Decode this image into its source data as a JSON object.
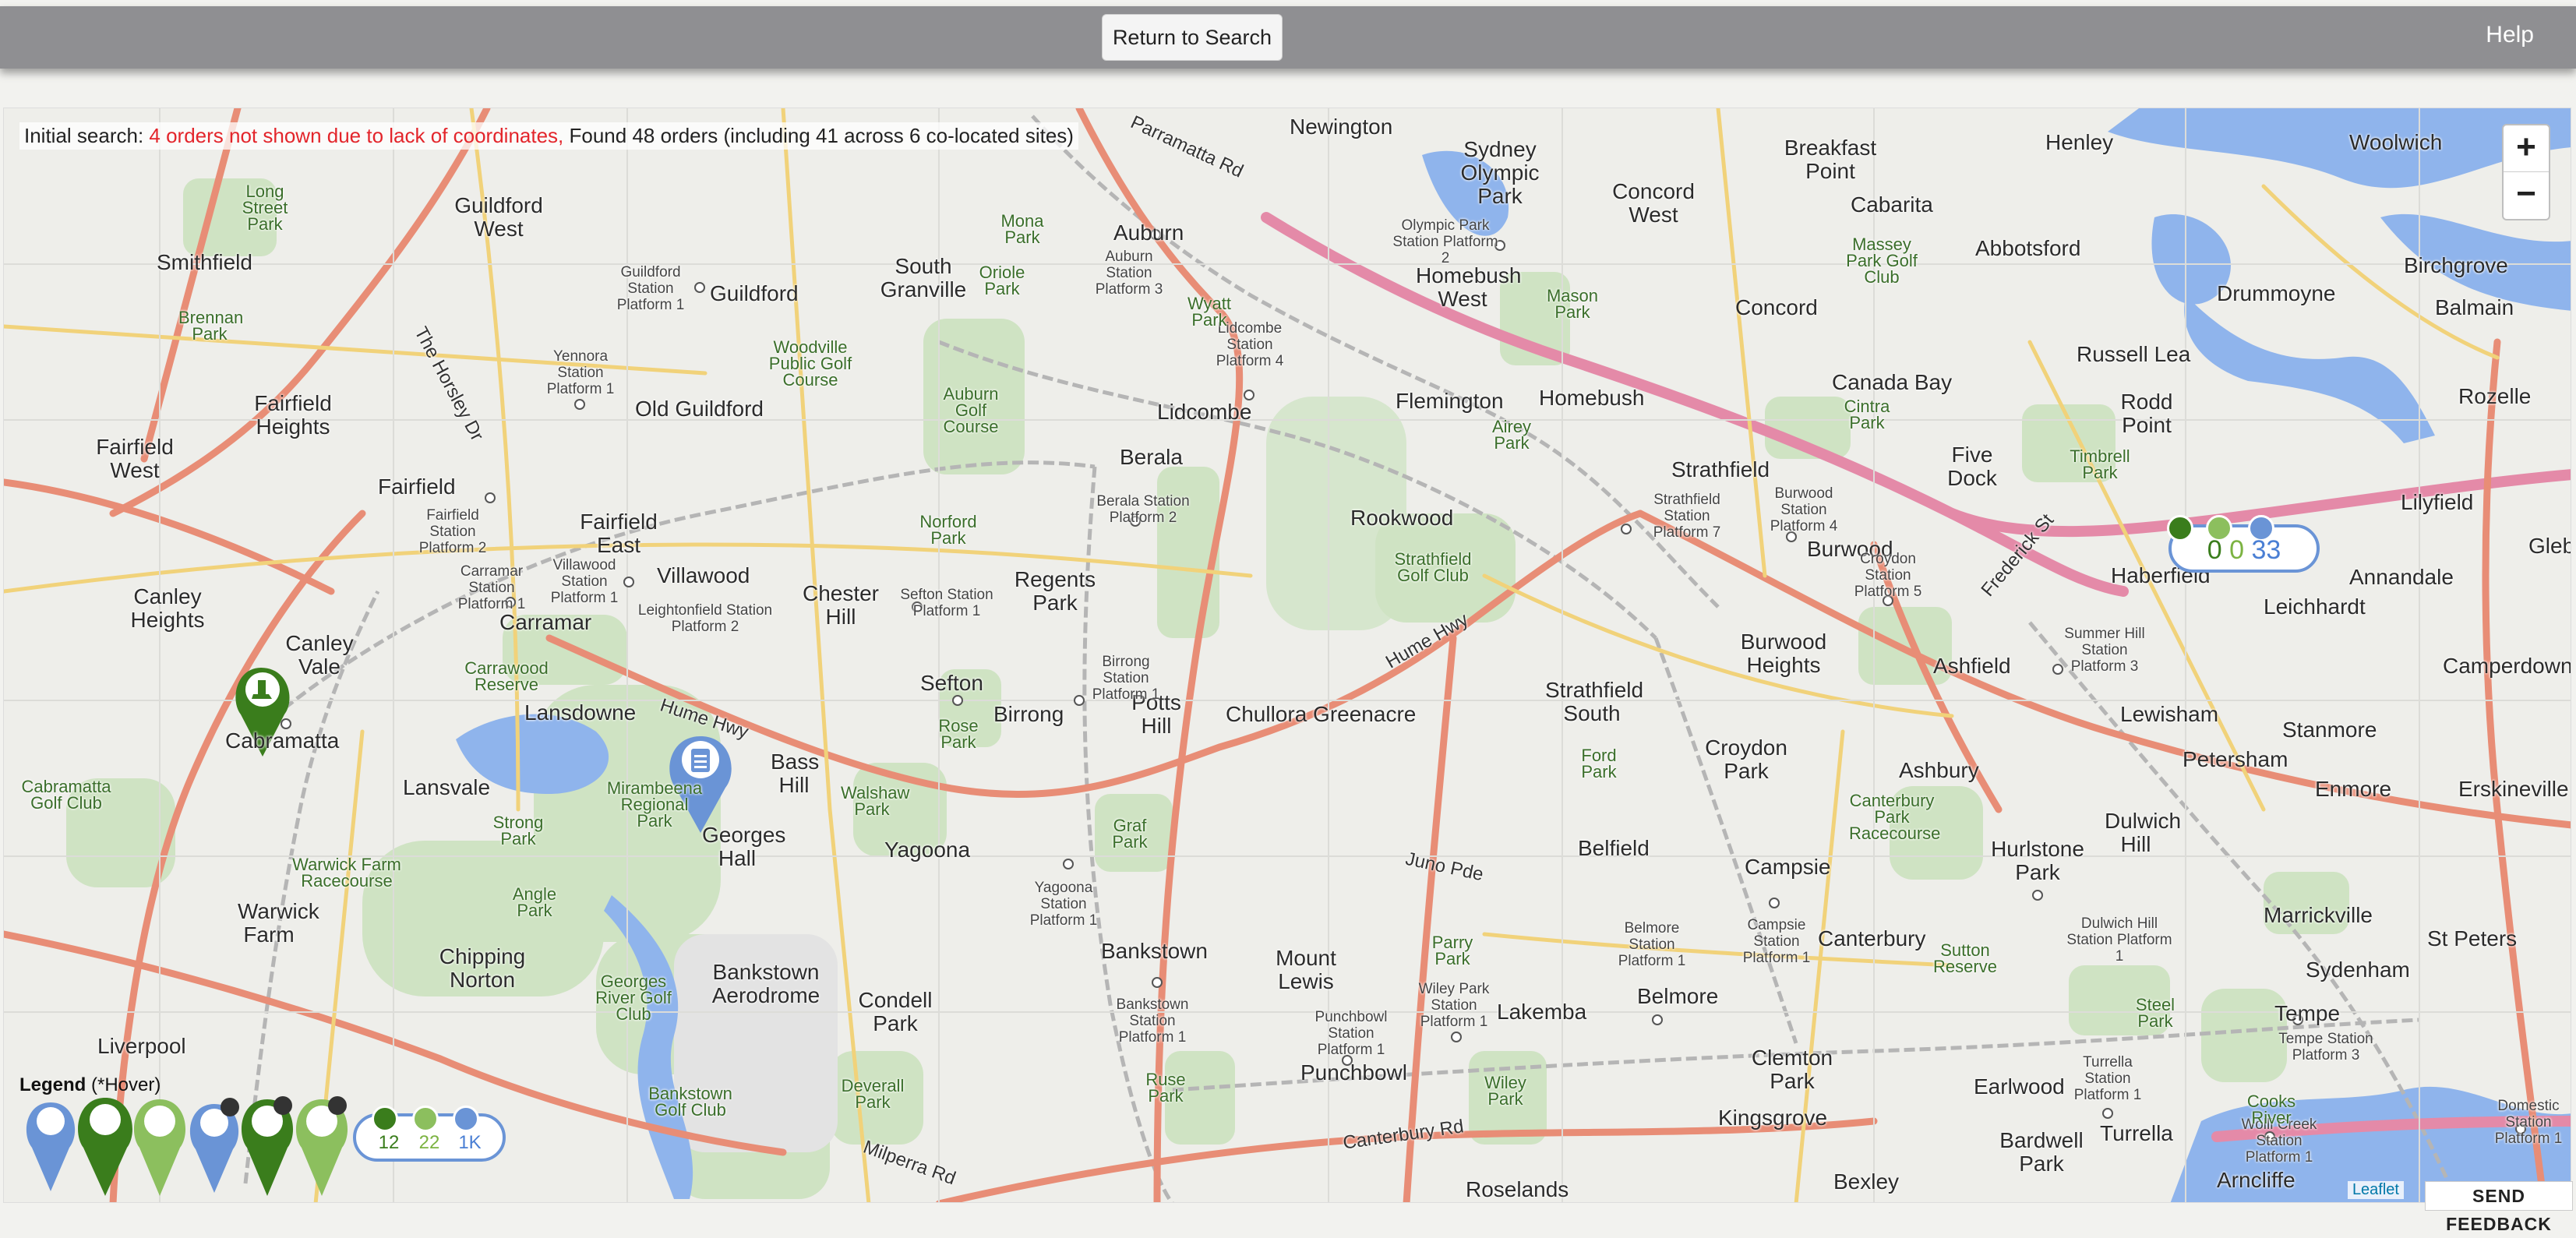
{
  "header": {
    "return_label": "Return to Search",
    "help_label": "Help"
  },
  "search": {
    "prefix": "Initial search: ",
    "warning": "4 orders not shown due to lack of coordinates,",
    "found": " Found 48 orders (including 41 across 6 co-located sites)"
  },
  "zoom": {
    "in": "+",
    "out": "−"
  },
  "cluster": {
    "green": "0",
    "lightgreen": "0",
    "blue": "33"
  },
  "legend": {
    "title": "Legend",
    "hint": " (*Hover)",
    "counts": {
      "green": "12",
      "lightgreen": "22",
      "blue": "1K"
    }
  },
  "attribution": "Leaflet",
  "feedback_label": "SEND FEEDBACK",
  "places": [
    {
      "id": "newington",
      "label": "Newington"
    },
    {
      "id": "sydney-olympic-park",
      "label": "Sydney Olympic Park"
    },
    {
      "id": "concord-west",
      "label": "Concord West"
    },
    {
      "id": "breakfast-point",
      "label": "Breakfast Point"
    },
    {
      "id": "henley",
      "label": "Henley"
    },
    {
      "id": "woolwich",
      "label": "Woolwich"
    },
    {
      "id": "guildford-west",
      "label": "Guildford West"
    },
    {
      "id": "smithfield",
      "label": "Smithfield"
    },
    {
      "id": "auburn",
      "label": "Auburn"
    },
    {
      "id": "cabarita",
      "label": "Cabarita"
    },
    {
      "id": "abbotsford",
      "label": "Abbotsford"
    },
    {
      "id": "birchgrove",
      "label": "Birchgrove"
    },
    {
      "id": "south-granville",
      "label": "South Granville"
    },
    {
      "id": "guildford",
      "label": "Guildford"
    },
    {
      "id": "homebush-west",
      "label": "Homebush West"
    },
    {
      "id": "concord",
      "label": "Concord"
    },
    {
      "id": "drummoyne",
      "label": "Drummoyne"
    },
    {
      "id": "balmain",
      "label": "Balmain"
    },
    {
      "id": "fairfield-heights",
      "label": "Fairfield Heights"
    },
    {
      "id": "lidcombe",
      "label": "Lidcombe"
    },
    {
      "id": "flemington",
      "label": "Flemington"
    },
    {
      "id": "homebush",
      "label": "Homebush"
    },
    {
      "id": "canada-bay",
      "label": "Canada Bay"
    },
    {
      "id": "russell-lea",
      "label": "Russell Lea"
    },
    {
      "id": "rodd-point",
      "label": "Rodd Point"
    },
    {
      "id": "rozelle",
      "label": "Rozelle"
    },
    {
      "id": "fairfield-west",
      "label": "Fairfield West"
    },
    {
      "id": "old-guildford",
      "label": "Old Guildford"
    },
    {
      "id": "berala",
      "label": "Berala"
    },
    {
      "id": "strathfield",
      "label": "Strathfield"
    },
    {
      "id": "five-dock",
      "label": "Five Dock"
    },
    {
      "id": "fairfield",
      "label": "Fairfield"
    },
    {
      "id": "rookwood",
      "label": "Rookwood"
    },
    {
      "id": "burwood",
      "label": "Burwood"
    },
    {
      "id": "lilyfield",
      "label": "Lilyfield"
    },
    {
      "id": "glebe",
      "label": "Glebe"
    },
    {
      "id": "fairfield-east",
      "label": "Fairfield East"
    },
    {
      "id": "villawood",
      "label": "Villawood"
    },
    {
      "id": "chester-hill",
      "label": "Chester Hill"
    },
    {
      "id": "regents-park",
      "label": "Regents Park"
    },
    {
      "id": "haberfield",
      "label": "Haberfield"
    },
    {
      "id": "annandale",
      "label": "Annandale"
    },
    {
      "id": "canley-heights",
      "label": "Canley Heights"
    },
    {
      "id": "carramar",
      "label": "Carramar"
    },
    {
      "id": "leichhardt",
      "label": "Leichhardt"
    },
    {
      "id": "canley-vale",
      "label": "Canley Vale"
    },
    {
      "id": "burwood-heights",
      "label": "Burwood Heights"
    },
    {
      "id": "ashfield",
      "label": "Ashfield"
    },
    {
      "id": "camperdown",
      "label": "Camperdown"
    },
    {
      "id": "sefton",
      "label": "Sefton"
    },
    {
      "id": "strathfield-south",
      "label": "Strathfield South"
    },
    {
      "id": "lansdowne",
      "label": "Lansdowne"
    },
    {
      "id": "potts-hill",
      "label": "Potts Hill"
    },
    {
      "id": "birrong",
      "label": "Birrong"
    },
    {
      "id": "chullora-greenacre",
      "label": "Chullora Greenacre"
    },
    {
      "id": "lewisham",
      "label": "Lewisham"
    },
    {
      "id": "stanmore",
      "label": "Stanmore"
    },
    {
      "id": "cabramatta",
      "label": "Cabramatta"
    },
    {
      "id": "croydon-park",
      "label": "Croydon Park"
    },
    {
      "id": "petersham",
      "label": "Petersham"
    },
    {
      "id": "bass-hill",
      "label": "Bass Hill"
    },
    {
      "id": "ashbury",
      "label": "Ashbury"
    },
    {
      "id": "enmore",
      "label": "Enmore"
    },
    {
      "id": "erskineville",
      "label": "Erskineville"
    },
    {
      "id": "lansvale",
      "label": "Lansvale"
    },
    {
      "id": "dulwich-hill",
      "label": "Dulwich Hill"
    },
    {
      "id": "georges-hall",
      "label": "Georges Hall"
    },
    {
      "id": "yagoona",
      "label": "Yagoona"
    },
    {
      "id": "belfield",
      "label": "Belfield"
    },
    {
      "id": "hurlstone-park",
      "label": "Hurlstone Park"
    },
    {
      "id": "campsie",
      "label": "Campsie"
    },
    {
      "id": "marrickville",
      "label": "Marrickville"
    },
    {
      "id": "warwick-farm",
      "label": "Warwick Farm"
    },
    {
      "id": "canterbury",
      "label": "Canterbury"
    },
    {
      "id": "st-peters",
      "label": "St Peters"
    },
    {
      "id": "chipping-norton",
      "label": "Chipping Norton"
    },
    {
      "id": "bankstown",
      "label": "Bankstown"
    },
    {
      "id": "mount-lewis",
      "label": "Mount Lewis"
    },
    {
      "id": "sydenham",
      "label": "Sydenham"
    },
    {
      "id": "bankstown-aerodrome",
      "label": "Bankstown Aerodrome"
    },
    {
      "id": "condell-park",
      "label": "Condell Park"
    },
    {
      "id": "lakemba",
      "label": "Lakemba"
    },
    {
      "id": "belmore",
      "label": "Belmore"
    },
    {
      "id": "tempe",
      "label": "Tempe"
    },
    {
      "id": "punchbowl",
      "label": "Punchbowl"
    },
    {
      "id": "clemton-park",
      "label": "Clemton Park"
    },
    {
      "id": "liverpool",
      "label": "Liverpool"
    },
    {
      "id": "earlwood",
      "label": "Earlwood"
    },
    {
      "id": "kingsgrove",
      "label": "Kingsgrove"
    },
    {
      "id": "turrella",
      "label": "Turrella"
    },
    {
      "id": "bardwell-park",
      "label": "Bardwell Park"
    },
    {
      "id": "roselands",
      "label": "Roselands"
    },
    {
      "id": "bexley",
      "label": "Bexley"
    },
    {
      "id": "arncliffe",
      "label": "Arncliffe"
    }
  ],
  "roads": [
    {
      "id": "parramatta-rd",
      "label": "Parramatta Rd"
    },
    {
      "id": "hume-hwy-west",
      "label": "Hume Hwy"
    },
    {
      "id": "hume-hwy-east",
      "label": "Hume Hwy"
    },
    {
      "id": "frederick-st",
      "label": "Frederick St"
    },
    {
      "id": "juno-pde",
      "label": "Juno Pde"
    },
    {
      "id": "canterbury-rd",
      "label": "Canterbury Rd"
    },
    {
      "id": "milperra-rd",
      "label": "Milperra Rd"
    },
    {
      "id": "the-horsley-dr",
      "label": "The Horsley Dr"
    }
  ],
  "stations": [
    {
      "id": "auburn-station",
      "label": "Auburn Station Platform 3"
    },
    {
      "id": "olympic-park-station",
      "label": "Olympic Park Station Platform 2"
    },
    {
      "id": "guildford-station",
      "label": "Guildford Station Platform 1"
    },
    {
      "id": "yennora-station",
      "label": "Yennora Station Platform 1"
    },
    {
      "id": "lidcombe-station",
      "label": "Lidcombe Station Platform 4"
    },
    {
      "id": "berala-station",
      "label": "Berala Station Platform 2"
    },
    {
      "id": "fairfield-station",
      "label": "Fairfield Station Platform 2"
    },
    {
      "id": "villawood-station",
      "label": "Villawood Station Platform 1"
    },
    {
      "id": "carramar-station",
      "label": "Carramar Station Platform 1"
    },
    {
      "id": "sefton-station",
      "label": "Sefton Station Platform 1"
    },
    {
      "id": "leightonfield-station",
      "label": "Leightonfield Station Platform 2"
    },
    {
      "id": "strathfield-station",
      "label": "Strathfield Station Platform 7"
    },
    {
      "id": "burwood-station",
      "label": "Burwood Station Platform 4"
    },
    {
      "id": "croydon-station",
      "label": "Croydon Station Platform 5"
    },
    {
      "id": "summer-hill-station",
      "label": "Summer Hill Station Platform 3"
    },
    {
      "id": "birrong-station",
      "label": "Birrong Station Platform 1"
    },
    {
      "id": "yagoona-station",
      "label": "Yagoona Station Platform 1"
    },
    {
      "id": "bankstown-station",
      "label": "Bankstown Station Platform 1"
    },
    {
      "id": "punchbowl-station",
      "label": "Punchbowl Station Platform 1"
    },
    {
      "id": "wiley-park-station",
      "label": "Wiley Park Station Platform 1"
    },
    {
      "id": "belmore-station",
      "label": "Belmore Station Platform 1"
    },
    {
      "id": "campsie-station",
      "label": "Campsie Station Platform 1"
    },
    {
      "id": "dulwich-hill-station",
      "label": "Dulwich Hill Station Platform 1"
    },
    {
      "id": "tempe-station",
      "label": "Tempe Station Platform 3"
    },
    {
      "id": "turrella-station",
      "label": "Turrella Station Platform 1"
    },
    {
      "id": "wolli-creek-station",
      "label": "Wolli Creek Station Platform 1"
    },
    {
      "id": "domestic-station",
      "label": "Domestic Station Platform 1"
    }
  ],
  "parks": [
    {
      "id": "long-street-park",
      "label": "Long Street Park"
    },
    {
      "id": "brennan-park",
      "label": "Brennan Park"
    },
    {
      "id": "woodville-golf",
      "label": "Woodville Public Golf Course"
    },
    {
      "id": "auburn-golf",
      "label": "Auburn Golf Course"
    },
    {
      "id": "mona-park",
      "label": "Mona Park"
    },
    {
      "id": "oriole-park",
      "label": "Oriole Park"
    },
    {
      "id": "wyatt-park",
      "label": "Wyatt Park"
    },
    {
      "id": "massey-park",
      "label": "Massey Park Golf Club"
    },
    {
      "id": "mason-park",
      "label": "Mason Park"
    },
    {
      "id": "airey-park",
      "label": "Airey Park"
    },
    {
      "id": "cintra-park",
      "label": "Cintra Park"
    },
    {
      "id": "timbrell-park",
      "label": "Timbrell Park"
    },
    {
      "id": "norford-park",
      "label": "Norford Park"
    },
    {
      "id": "strathfield-golf",
      "label": "Strathfield Golf Club"
    },
    {
      "id": "carrawood-reserve",
      "label": "Carrawood Reserve"
    },
    {
      "id": "mirambeena",
      "label": "Mirambeena Regional Park"
    },
    {
      "id": "strong-park",
      "label": "Strong Park"
    },
    {
      "id": "rose-park",
      "label": "Rose Park"
    },
    {
      "id": "walshaw-park",
      "label": "Walshaw Park"
    },
    {
      "id": "graf-park",
      "label": "Graf Park"
    },
    {
      "id": "ford-park",
      "label": "Ford Park"
    },
    {
      "id": "cabramatta-golf",
      "label": "Cabramatta Golf Club"
    },
    {
      "id": "warwick-farm-racecourse",
      "label": "Warwick Farm Racecourse"
    },
    {
      "id": "angle-park",
      "label": "Angle Park"
    },
    {
      "id": "parry-park",
      "label": "Parry Park"
    },
    {
      "id": "canterbury-racecourse",
      "label": "Canterbury Park Racecourse"
    },
    {
      "id": "sutton-reserve",
      "label": "Sutton Reserve"
    },
    {
      "id": "georges-river-golf",
      "label": "Georges River Golf Club"
    },
    {
      "id": "bankstown-golf",
      "label": "Bankstown Golf Club"
    },
    {
      "id": "deverall-park",
      "label": "Deverall Park"
    },
    {
      "id": "ruse-park",
      "label": "Ruse Park"
    },
    {
      "id": "wiley-park",
      "label": "Wiley Park"
    },
    {
      "id": "steel-park",
      "label": "Steel Park"
    },
    {
      "id": "cooks-river",
      "label": "Cooks River"
    }
  ]
}
